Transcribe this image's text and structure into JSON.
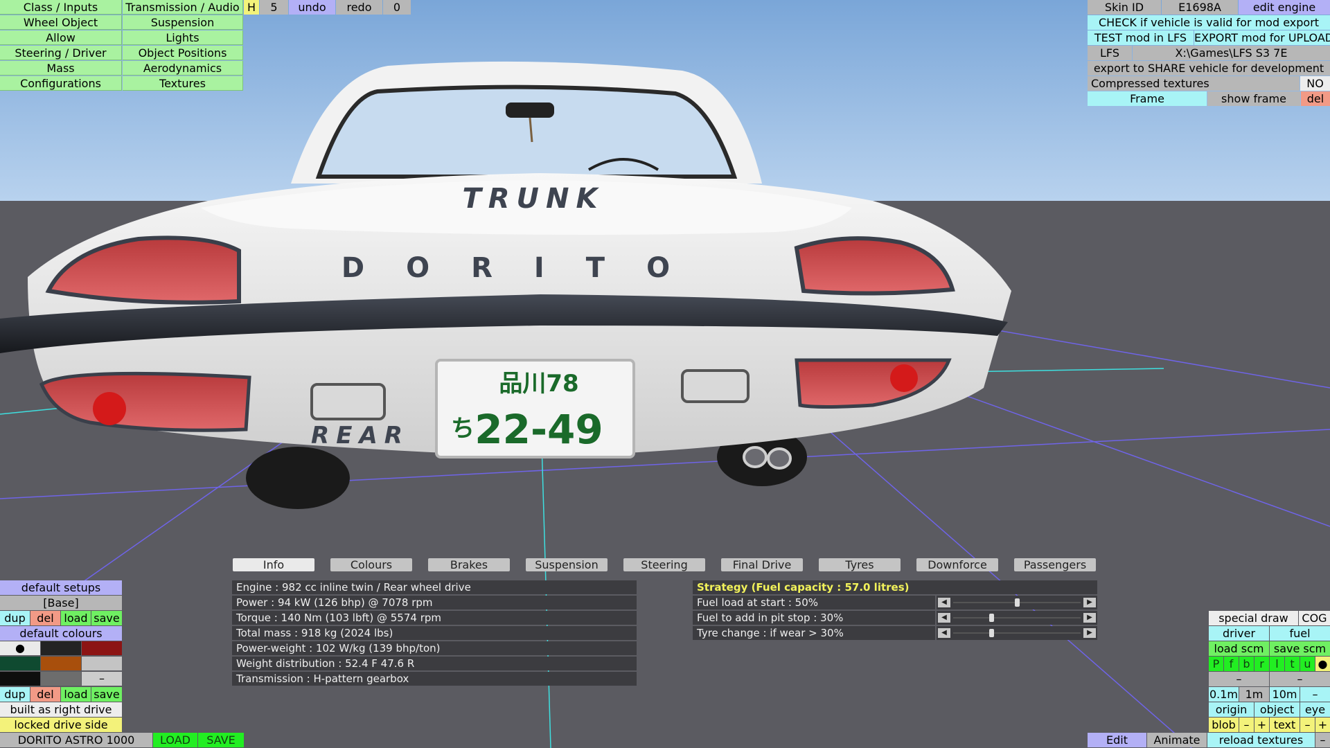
{
  "scene": {
    "trunk_text": "TRUNK",
    "brand_text": "DORITO",
    "rear_text": "REAR",
    "plate_top": "品川78",
    "plate_kana": "ち",
    "plate_number": "22-49"
  },
  "top_menu": {
    "col1": [
      "Class / Inputs",
      "Wheel Object",
      "Allow",
      "Steering / Driver",
      "Mass",
      "Configurations"
    ],
    "col2": [
      "Transmission / Audio",
      "Suspension",
      "Lights",
      "Object Positions",
      "Aerodynamics",
      "Textures"
    ],
    "mode_h": "H",
    "mode_num": "5",
    "undo": "undo",
    "redo": "redo",
    "redo_count": "0"
  },
  "top_right": {
    "skin_id_label": "Skin ID",
    "skin_id_value": "E1698A",
    "edit_engine": "edit engine",
    "check_valid": "CHECK if vehicle is valid for mod export",
    "test_mod": "TEST mod in LFS",
    "export_mod": "EXPORT mod for UPLOAD",
    "lfs_label": "LFS",
    "lfs_path": "X:\\Games\\LFS S3 7E",
    "export_share": "export to SHARE vehicle for development",
    "compressed_label": "Compressed textures",
    "compressed_value": "NO",
    "frame": "Frame",
    "show_frame": "show frame",
    "del": "del"
  },
  "tabs": [
    "Info",
    "Colours",
    "Brakes",
    "Suspension",
    "Steering",
    "Final Drive",
    "Tyres",
    "Downforce",
    "Passengers"
  ],
  "info_lines": [
    "Engine : 982 cc inline twin / Rear wheel drive",
    "Power : 94 kW (126 bhp) @ 7078 rpm",
    "Torque : 140 Nm (103 lbft) @ 5574 rpm",
    "Total mass : 918 kg (2024 lbs)",
    "Power-weight : 102 W/kg (139 bhp/ton)",
    "Weight distribution : 52.4 F  47.6 R",
    "Transmission : H-pattern gearbox"
  ],
  "strategy": {
    "title": "Strategy (Fuel capacity : 57.0 litres)",
    "rows": [
      {
        "label": "Fuel load at start : 50%",
        "value": 0.5
      },
      {
        "label": "Fuel to add in pit stop : 30%",
        "value": 0.3
      },
      {
        "label": "Tyre change : if wear > 30%",
        "value": 0.3
      }
    ]
  },
  "left_panel": {
    "default_setups": "default setups",
    "base": "[Base]",
    "dup": "dup",
    "del": "del",
    "load": "load",
    "save": "save",
    "default_colours": "default colours",
    "dot": "●",
    "dash": "–",
    "dup2": "dup",
    "del2": "del",
    "load2": "load",
    "save2": "save",
    "built_right": "built as right drive",
    "locked_side": "locked drive side",
    "swatch_colors": [
      "#eaeaea",
      "#232323",
      "#8c1414",
      "#0f4a30",
      "#a84f0c",
      "#c4c4c4",
      "#0e0e0e",
      "#6d6d6d",
      "#cccccc"
    ]
  },
  "bottom_bar": {
    "vehicle_name": "DORITO ASTRO 1000",
    "load": "LOAD",
    "save": "SAVE",
    "edit": "Edit",
    "animate": "Animate",
    "reload_textures": "reload textures",
    "minus": "–"
  },
  "right_panel": {
    "special_draw": "special draw",
    "cog": "COG",
    "driver": "driver",
    "fuel": "fuel",
    "load_scm": "load scm",
    "save_scm": "save scm",
    "letters": [
      "P",
      "f",
      "b",
      "r",
      "l",
      "t",
      "u",
      "●"
    ],
    "dash1": "–",
    "dash2": "–",
    "scale1": "0.1m",
    "scale2": "1m",
    "scale3": "10m",
    "scale_minus": "–",
    "origin": "origin",
    "object": "object",
    "eye": "eye",
    "blob": "blob",
    "blob_minus": "–",
    "blob_plus": "+",
    "text": "text",
    "text_minus": "–",
    "text_plus": "+"
  }
}
